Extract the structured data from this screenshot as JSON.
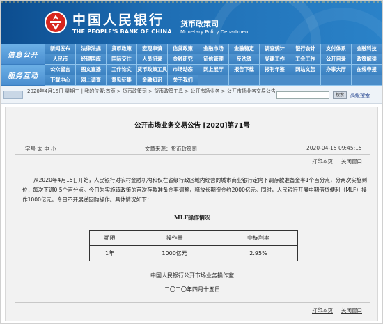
{
  "header": {
    "bank_cn": "中国人民银行",
    "bank_en": "THE PEOPLE'S BANK OF CHINA",
    "dept_cn": "货币政策司",
    "dept_en": "Monetary Policy Department",
    "colors": {
      "primary": "#1e6db3",
      "logo_red": "#d7261e",
      "nav": "#4f93cf"
    }
  },
  "nav": {
    "side_top": "信息公开",
    "side_bottom": "服务互动",
    "row1": [
      "新闻发布",
      "法律法规",
      "货币政策",
      "宏观审慎",
      "信贷政策",
      "金融市场",
      "金融稳定",
      "调查统计",
      "银行会计",
      "支付体系",
      "金融科技"
    ],
    "row2": [
      "人民币",
      "经理国库",
      "国际交往",
      "人员招录",
      "金融研究",
      "征信管理",
      "反洗钱",
      "党建工作",
      "工会工作",
      "公开目录",
      "政策解读"
    ],
    "row3": [
      "公众留言",
      "图文直播",
      "工作论文",
      "货币政策工具",
      "市场动态",
      "网上展厅",
      "报告下载",
      "报刊年鉴",
      "网站文告",
      "办事大厅",
      "在线申报"
    ],
    "row4": [
      "下载中心",
      "网上调查",
      "意见征集",
      "金融知识",
      "关于我们"
    ]
  },
  "breadcrumb": {
    "text": "2020年4月15日 星期三 | 我的位置:首页 > 货币政策司 > 货币政策工具 > 公开市场业务 > 公开市场业务交易公告",
    "search_button": "搜索",
    "advanced_search": "高级搜索"
  },
  "article": {
    "title": "公开市场业务交易公告 [2020]第71号",
    "font_size": "字号 太 中 小",
    "source": "文章来源：货币政策司",
    "date": "2020-04-15 09:45:15",
    "print": "打印本页",
    "close": "关闭窗口",
    "body": "从2020年4月15日开始，人民银行对农村金融机构和仅在省级行政区域内经营的城市商业银行定向下调存款准备金率1个百分点，分两次实施到位，每次下调0.5个百分点。今日为实施该政策的首次存款准备金率调整，释放长期资金约2000亿元。同时，人民银行开展中期借贷便利（MLF）操作1000亿元。今日不开展逆回购操作。具体情况如下：",
    "table_title": "MLF操作情况",
    "table": {
      "headers": [
        "期限",
        "操作量",
        "中标利率"
      ],
      "rows": [
        [
          "1年",
          "1000亿元",
          "2.95%"
        ]
      ]
    },
    "signature": "中国人民银行公开市场业务操作室",
    "sign_date": "二〇二〇年四月十五日"
  }
}
